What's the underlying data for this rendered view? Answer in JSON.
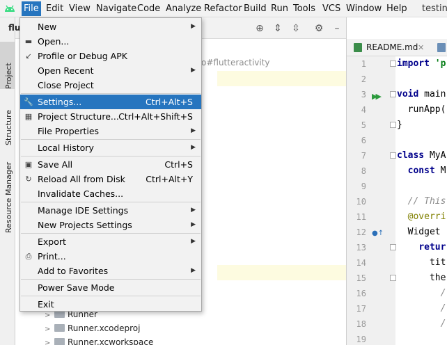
{
  "menubar": {
    "items": [
      "File",
      "Edit",
      "View",
      "Navigate",
      "Code",
      "Analyze",
      "Refactor",
      "Build",
      "Run",
      "Tools",
      "VCS",
      "Window",
      "Help"
    ],
    "window_title": "testing"
  },
  "tool_windows": {
    "project": "Project",
    "structure": "Structure",
    "resource_manager": "Resource Manager"
  },
  "project_pane": {
    "title": "flut",
    "path_hint": "o#flutteractivity",
    "tree": [
      "Runner",
      "Runner.xcodeproj",
      "Runner.xcworkspace"
    ]
  },
  "editor": {
    "tab_label": "README.md",
    "lines": [
      {
        "n": "1"
      },
      {
        "n": "2"
      },
      {
        "n": "3"
      },
      {
        "n": "4"
      },
      {
        "n": "5"
      },
      {
        "n": "6"
      },
      {
        "n": "7"
      },
      {
        "n": "8"
      },
      {
        "n": "9"
      },
      {
        "n": "10"
      },
      {
        "n": "11"
      },
      {
        "n": "12"
      },
      {
        "n": "13"
      },
      {
        "n": "14"
      },
      {
        "n": "15"
      },
      {
        "n": "16"
      },
      {
        "n": "17"
      },
      {
        "n": "18"
      },
      {
        "n": "19"
      }
    ],
    "code": {
      "l1_kw": "import",
      "l1_str": "'p",
      "l3_kw": "void",
      "l3_rest": " main",
      "l4": "  runApp(",
      "l5": "}",
      "l7_kw": "class",
      "l7_rest": " MyA",
      "l8_kw": "const",
      "l8_rest": " M",
      "l10": "  // This",
      "l11": "  @overri",
      "l12": "  Widget",
      "l13_kw": "retur",
      "l14": "      tit",
      "l15": "      the",
      "l16": "        /",
      "l17": "        /",
      "l18": "        /"
    }
  },
  "file_menu": {
    "items": [
      {
        "label": "New",
        "shortcut": "",
        "submenu": true,
        "icon": ""
      },
      {
        "label": "Open...",
        "shortcut": "",
        "submenu": false,
        "icon": "folder-icon"
      },
      {
        "label": "Profile or Debug APK",
        "shortcut": "",
        "submenu": false,
        "icon": "apk-icon"
      },
      {
        "label": "Open Recent",
        "shortcut": "",
        "submenu": true,
        "icon": ""
      },
      {
        "label": "Close Project",
        "shortcut": "",
        "submenu": false,
        "icon": ""
      },
      {
        "label": "Settings...",
        "shortcut": "Ctrl+Alt+S",
        "submenu": false,
        "icon": "wrench-icon"
      },
      {
        "label": "Project Structure...",
        "shortcut": "Ctrl+Alt+Shift+S",
        "submenu": false,
        "icon": "project-structure-icon"
      },
      {
        "label": "File Properties",
        "shortcut": "",
        "submenu": true,
        "icon": ""
      },
      {
        "label": "Local History",
        "shortcut": "",
        "submenu": true,
        "icon": ""
      },
      {
        "label": "Save All",
        "shortcut": "Ctrl+S",
        "submenu": false,
        "icon": "save-icon"
      },
      {
        "label": "Reload All from Disk",
        "shortcut": "Ctrl+Alt+Y",
        "submenu": false,
        "icon": "reload-icon"
      },
      {
        "label": "Invalidate Caches...",
        "shortcut": "",
        "submenu": false,
        "icon": ""
      },
      {
        "label": "Manage IDE Settings",
        "shortcut": "",
        "submenu": true,
        "icon": ""
      },
      {
        "label": "New Projects Settings",
        "shortcut": "",
        "submenu": true,
        "icon": ""
      },
      {
        "label": "Export",
        "shortcut": "",
        "submenu": true,
        "icon": ""
      },
      {
        "label": "Print...",
        "shortcut": "",
        "submenu": false,
        "icon": "print-icon"
      },
      {
        "label": "Add to Favorites",
        "shortcut": "",
        "submenu": true,
        "icon": ""
      },
      {
        "label": "Power Save Mode",
        "shortcut": "",
        "submenu": false,
        "icon": ""
      },
      {
        "label": "Exit",
        "shortcut": "",
        "submenu": false,
        "icon": ""
      }
    ],
    "highlighted": "Settings..."
  },
  "colors": {
    "accent": "#2675bf",
    "menu_bg": "#f2f2f2",
    "keyword": "#00008b"
  }
}
